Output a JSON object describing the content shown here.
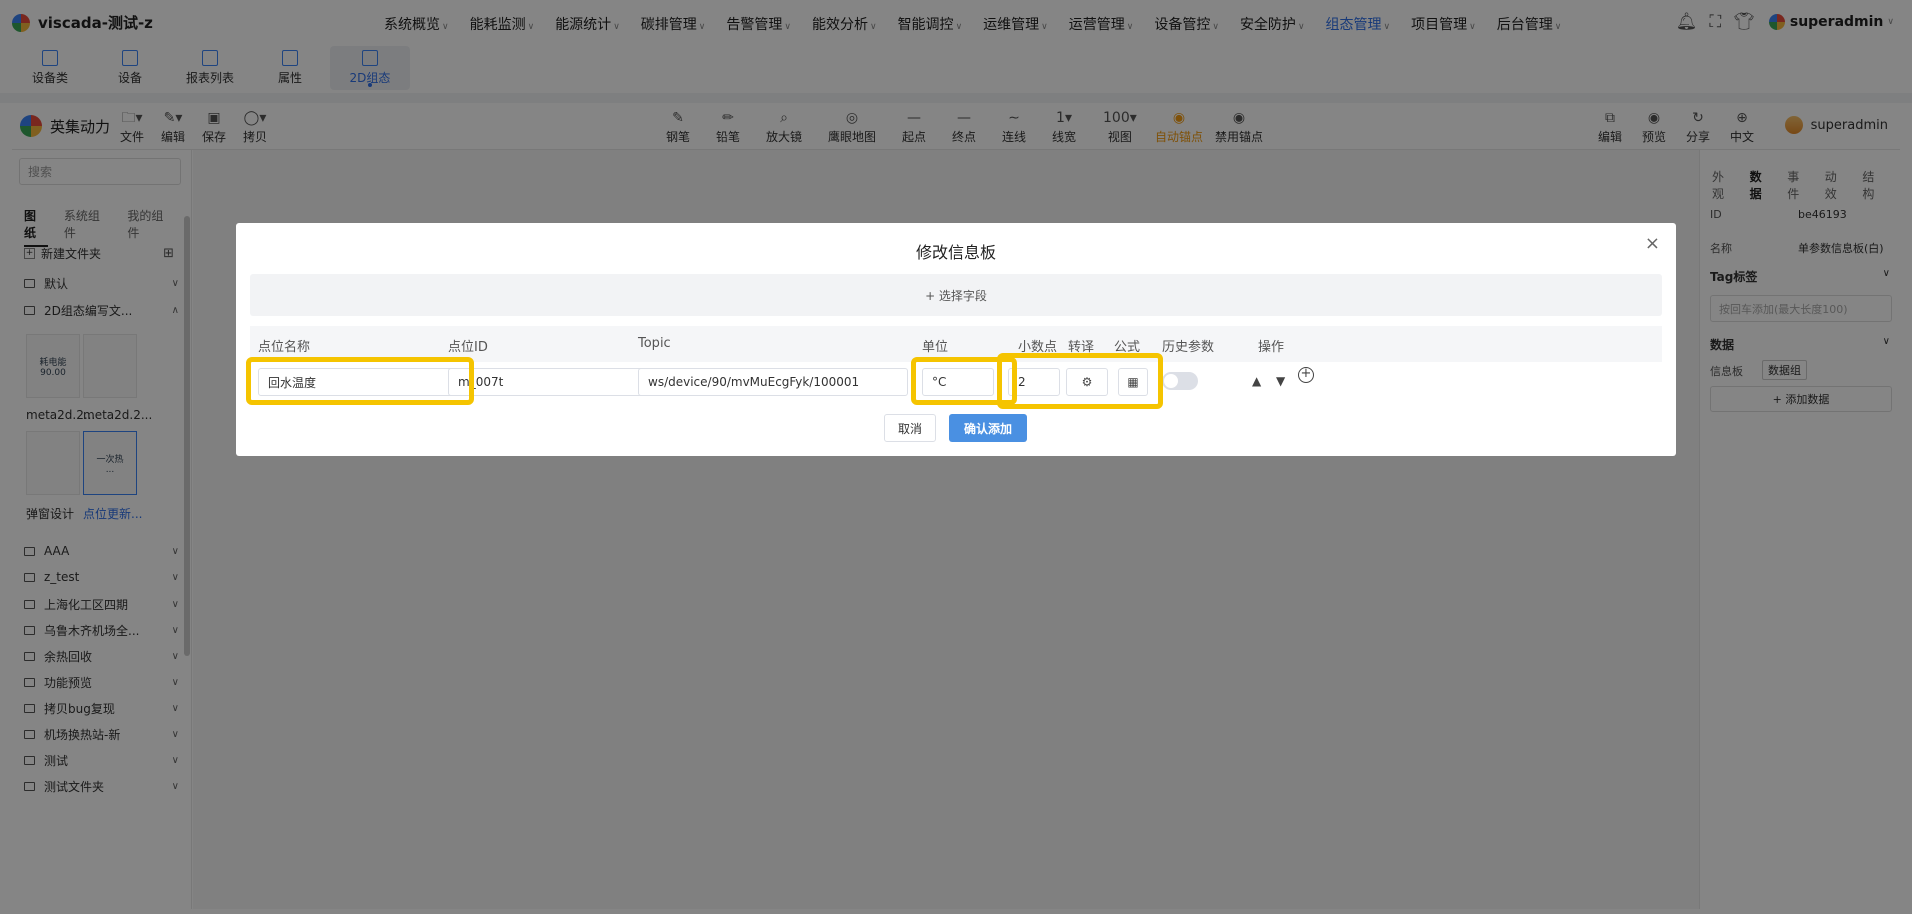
{
  "app": {
    "title": "viscada-测试-z"
  },
  "nav": {
    "menus": [
      {
        "label": "系统概览"
      },
      {
        "label": "能耗监测"
      },
      {
        "label": "能源统计"
      },
      {
        "label": "碳排管理"
      },
      {
        "label": "告警管理"
      },
      {
        "label": "能效分析"
      },
      {
        "label": "智能调控"
      },
      {
        "label": "运维管理"
      },
      {
        "label": "运营管理"
      },
      {
        "label": "设备管控"
      },
      {
        "label": "安全防护"
      },
      {
        "label": "组态管理"
      },
      {
        "label": "项目管理"
      },
      {
        "label": "后台管理"
      }
    ],
    "active_menu": "组态管理",
    "user": "superadmin"
  },
  "subtabs": [
    {
      "label": "设备类"
    },
    {
      "label": "设备"
    },
    {
      "label": "报表列表"
    },
    {
      "label": "属性"
    },
    {
      "label": "2D组态"
    }
  ],
  "editor": {
    "brand": "英集动力",
    "left_tools": [
      {
        "label": "文件"
      },
      {
        "label": "编辑"
      },
      {
        "label": "保存"
      },
      {
        "label": "拷贝"
      }
    ],
    "center_tools": [
      {
        "label": "钢笔",
        "glyph": "✎"
      },
      {
        "label": "铅笔",
        "glyph": "✏"
      },
      {
        "label": "放大镜",
        "glyph": "⌕"
      },
      {
        "label": "鹰眼地图",
        "glyph": "◎"
      },
      {
        "label": "起点",
        "glyph": "—"
      },
      {
        "label": "终点",
        "glyph": "—"
      },
      {
        "label": "连线",
        "glyph": "∼"
      },
      {
        "label": "线宽",
        "glyph": "1▾"
      },
      {
        "label": "视图",
        "glyph": "100▾"
      },
      {
        "label": "自动锚点",
        "glyph": "◉"
      },
      {
        "label": "禁用锚点",
        "glyph": "◉"
      }
    ],
    "right_tools": [
      {
        "label": "编辑"
      },
      {
        "label": "预览"
      },
      {
        "label": "分享"
      },
      {
        "label": "中文"
      }
    ],
    "user": "superadmin"
  },
  "sidebar": {
    "search_placeholder": "搜索",
    "tabs": [
      {
        "label": "图纸"
      },
      {
        "label": "系统组件"
      },
      {
        "label": "我的组件"
      }
    ],
    "new_folder": "新建文件夹",
    "folders_top": [
      {
        "label": "默认"
      },
      {
        "label": "2D组态编写文..."
      }
    ],
    "thumbs": [
      {
        "label": "meta2d.2...",
        "text": "耗电能\n90.00"
      },
      {
        "label": "meta2d.2...",
        "text": ""
      },
      {
        "label": "弹窗设计",
        "text": ""
      },
      {
        "label": "点位更新...",
        "text": "一次热\n..."
      }
    ],
    "folders": [
      {
        "label": "AAA"
      },
      {
        "label": "z_test"
      },
      {
        "label": "上海化工区四期"
      },
      {
        "label": "乌鲁木齐机场全..."
      },
      {
        "label": "余热回收"
      },
      {
        "label": "功能预览"
      },
      {
        "label": "拷贝bug复现"
      },
      {
        "label": "机场换热站-新"
      },
      {
        "label": "测试"
      },
      {
        "label": "测试文件夹"
      }
    ]
  },
  "rpanel": {
    "tabs": [
      {
        "label": "外观"
      },
      {
        "label": "数据"
      },
      {
        "label": "事件"
      },
      {
        "label": "动效"
      },
      {
        "label": "结构"
      }
    ],
    "id_label": "ID",
    "id_value": "be46193",
    "name_label": "名称",
    "name_value": "单参数信息板(白)",
    "tag_label": "Tag标签",
    "tag_placeholder": "按回车添加(最大长度100)",
    "data_label": "数据",
    "board_label": "信息板",
    "board_badge": "数据组",
    "add_data": "+ 添加数据"
  },
  "modal": {
    "title": "修改信息板",
    "pick_field": "+ 选择字段",
    "headers": {
      "name": "点位名称",
      "id": "点位ID",
      "topic": "Topic",
      "unit": "单位",
      "decimal": "小数点",
      "translate": "转译",
      "formula": "公式",
      "history": "历史参数",
      "ops": "操作"
    },
    "row": {
      "name": "回水温度",
      "id": "m_007t",
      "topic": "ws/device/90/mvMuEcgFyk/100001",
      "unit": "°C",
      "decimal": "2",
      "history_enabled": false
    },
    "cancel": "取消",
    "confirm": "确认添加"
  },
  "colors": {
    "accent": "#2f6fe8",
    "highlight": "#f5c400",
    "confirm": "#4a90e2"
  },
  "icons": {
    "translate": "gear-icon",
    "formula": "calculator-icon",
    "close": "close-icon",
    "up": "arrow-up-icon",
    "down": "arrow-down-icon",
    "add": "plus-circle-icon"
  }
}
